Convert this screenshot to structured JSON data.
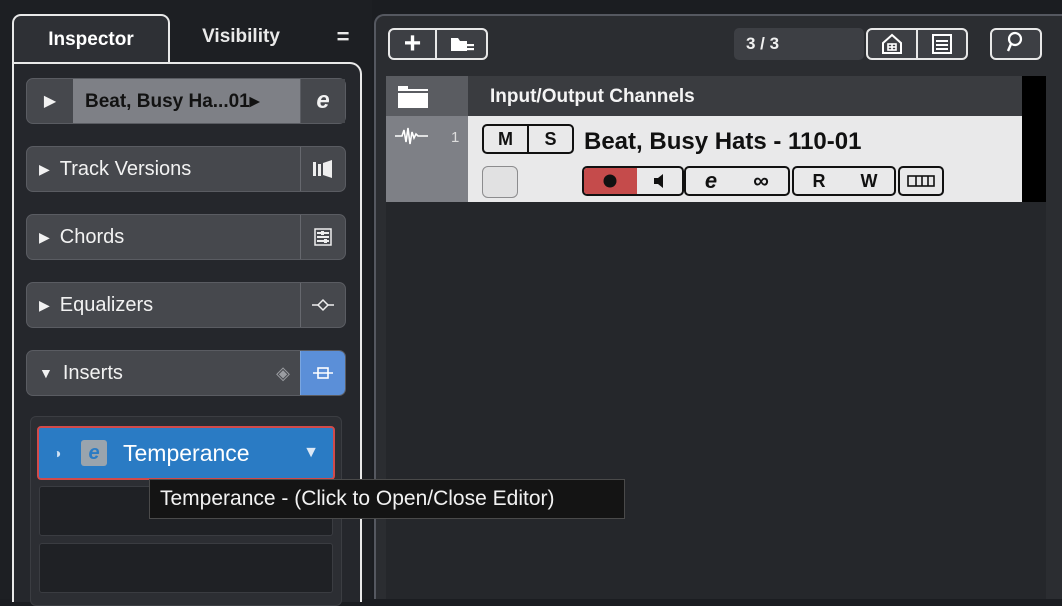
{
  "inspector": {
    "tabs": [
      {
        "label": "Inspector"
      },
      {
        "label": "Visibility"
      }
    ],
    "menu_symbol": "=",
    "track_section": {
      "name": "Beat, Busy Ha...01▸",
      "edit_symbol": "e"
    },
    "sections": {
      "versions": "Track Versions",
      "chords": "Chords",
      "equalizers": "Equalizers",
      "inserts": "Inserts"
    },
    "insert_slot": {
      "name": "Temperance",
      "edit_symbol": "e"
    }
  },
  "toolbar": {
    "counter": "3 / 3"
  },
  "track_list": {
    "folder_title": "Input/Output Channels",
    "track": {
      "number": "1",
      "name": "Beat, Busy Hats - 110-01",
      "mute": "M",
      "solo": "S",
      "read": "R",
      "write": "W",
      "edit_symbol": "e",
      "link_symbol": "∞"
    }
  },
  "tooltip": {
    "text": "Temperance - (Click to Open/Close Editor)"
  },
  "colors": {
    "accent_blue": "#2a7bc4",
    "record_red": "#c54b4b",
    "inserts_toggle_blue": "#5b8fd8"
  },
  "icons": [
    "plus-icon",
    "folder-add-icon",
    "project-icon",
    "list-icon",
    "search-icon",
    "folder-icon",
    "waveform-icon",
    "record-icon",
    "monitor-icon",
    "lanes-icon",
    "chevron-right-icon",
    "play-icon",
    "track-versions-icon",
    "chords-icon",
    "equalizer-icon",
    "insert-bypass-icon",
    "dropdown-arrow-icon"
  ]
}
